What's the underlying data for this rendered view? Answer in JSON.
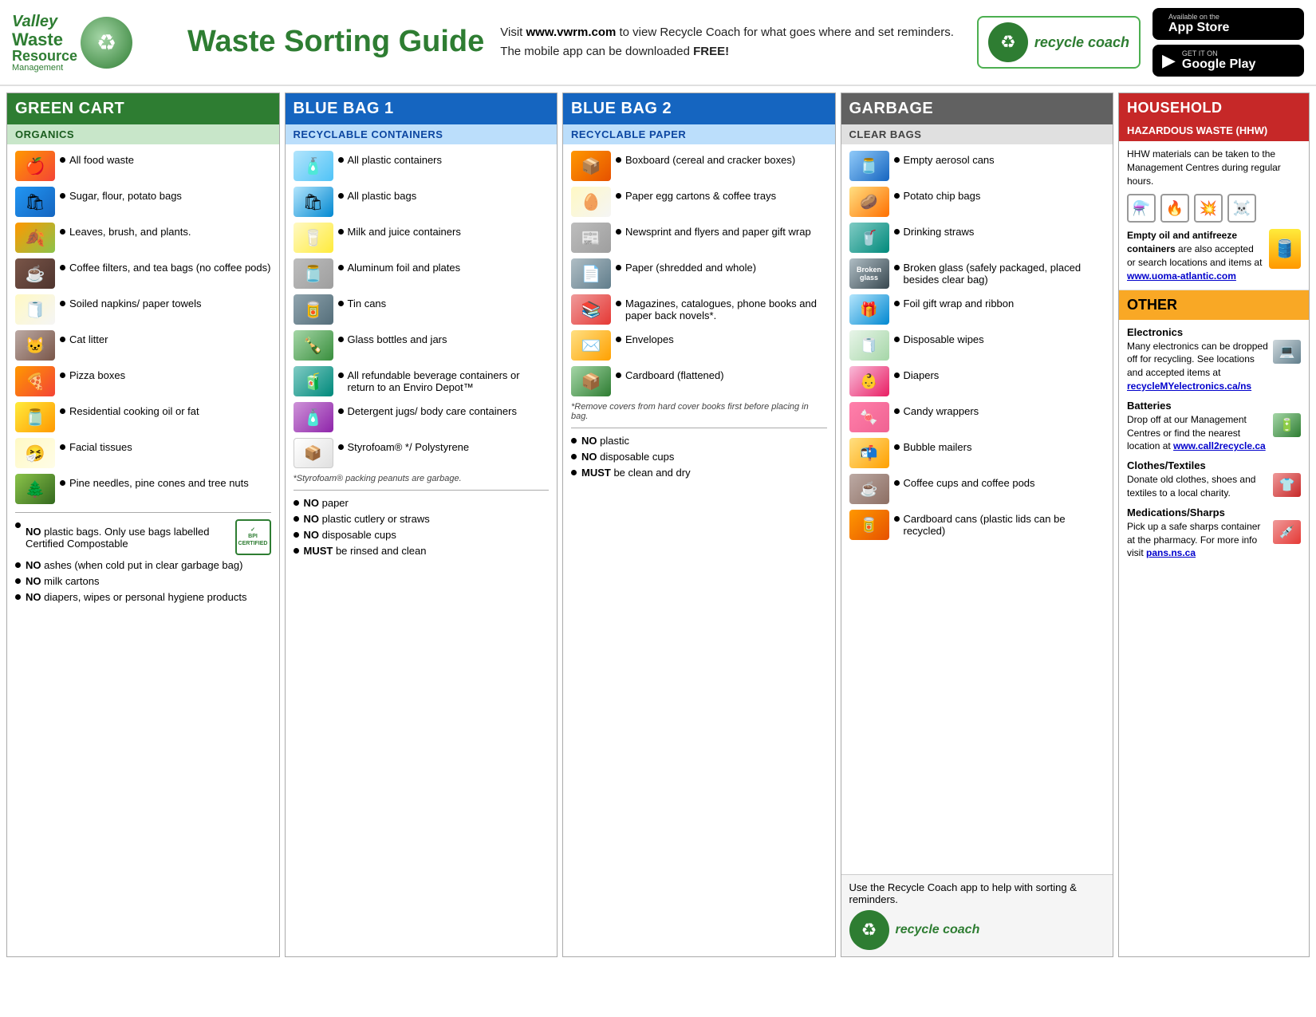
{
  "header": {
    "logo": {
      "line1": "Valley",
      "line2": "Waste",
      "line3": "Resource",
      "line4": "Management"
    },
    "title": "Waste Sorting Guide",
    "description": "Visit www.vwrm.com to view Recycle Coach for what goes where and set reminders. The mobile app can be downloaded FREE!",
    "website": "www.vwrm.com",
    "recycle_coach": "recycle coach",
    "app_store": "Available on App Store",
    "google_play": "Google GET IT ON Play"
  },
  "columns": {
    "green": {
      "header": "GREEN CART",
      "subheader": "ORGANICS",
      "items": [
        {
          "text": "All food waste"
        },
        {
          "text": "Sugar, flour, potato bags"
        },
        {
          "text": "Leaves, brush, and plants."
        },
        {
          "text": "Coffee filters, and tea bags (no coffee pods)"
        },
        {
          "text": "Soiled napkins/ paper towels"
        },
        {
          "text": "Cat litter"
        },
        {
          "text": "Pizza boxes"
        },
        {
          "text": "Residential cooking oil or fat"
        },
        {
          "text": "Facial tissues"
        },
        {
          "text": "Pine needles, pine cones and tree nuts"
        }
      ],
      "no_items": [
        {
          "text": "NO plastic bags. Only use bags labelled Certified Compostable"
        },
        {
          "text": "NO ashes (when cold put in clear garbage bag)"
        },
        {
          "text": "NO milk cartons"
        },
        {
          "text": "NO diapers, wipes or personal hygiene products"
        }
      ]
    },
    "blue1": {
      "header": "BLUE BAG 1",
      "subheader": "RECYCLABLE CONTAINERS",
      "items": [
        {
          "text": "All plastic containers"
        },
        {
          "text": "All plastic bags"
        },
        {
          "text": "Milk and juice containers"
        },
        {
          "text": "Aluminum foil and plates"
        },
        {
          "text": "Tin cans"
        },
        {
          "text": "Glass bottles and jars"
        },
        {
          "text": "All refundable beverage containers or return to an Enviro Depot™"
        },
        {
          "text": "Detergent jugs/ body care containers"
        },
        {
          "text": "Styrofoam® */ Polystyrene"
        }
      ],
      "note": "*Styrofoam® packing peanuts are garbage.",
      "no_items": [
        {
          "text": "NO paper"
        },
        {
          "text": "NO plastic cutlery or straws"
        },
        {
          "text": "NO disposable cups"
        },
        {
          "text": "MUST be rinsed and clean"
        }
      ]
    },
    "blue2": {
      "header": "BLUE BAG 2",
      "subheader": "RECYCLABLE PAPER",
      "items": [
        {
          "text": "Boxboard (cereal and cracker boxes)"
        },
        {
          "text": "Paper egg cartons  & coffee trays"
        },
        {
          "text": "Newsprint and flyers and paper gift wrap"
        },
        {
          "text": "Paper (shredded and whole)"
        },
        {
          "text": "Magazines, catalogues, phone books and paper back novels*."
        },
        {
          "text": "Envelopes"
        },
        {
          "text": "Cardboard (flattened)"
        }
      ],
      "note": "*Remove covers from hard cover books first before placing in bag.",
      "no_items": [
        {
          "text": "NO plastic"
        },
        {
          "text": "NO disposable cups"
        },
        {
          "text": "MUST be clean and dry"
        }
      ]
    },
    "garbage": {
      "header": "GARBAGE",
      "subheader": "CLEAR BAGS",
      "items": [
        {
          "text": "Empty aerosol cans"
        },
        {
          "text": "Potato chip bags"
        },
        {
          "text": "Drinking straws"
        },
        {
          "text": "Broken glass (safely packaged, placed besides clear bag)"
        },
        {
          "text": "Foil gift wrap and ribbon"
        },
        {
          "text": "Disposable wipes"
        },
        {
          "text": "Diapers"
        },
        {
          "text": "Candy wrappers"
        },
        {
          "text": "Bubble mailers"
        },
        {
          "text": "Coffee cups and coffee pods"
        },
        {
          "text": "Cardboard cans (plastic lids can be recycled)"
        }
      ],
      "footer_text": "Use the Recycle Coach app to help with sorting & reminders."
    },
    "hhw": {
      "header": "HOUSEHOLD",
      "subheader": "HAZARDOUS WASTE (HHW)",
      "body_text": "HHW materials can be taken to the Management Centres during regular hours.",
      "highlight1": "Empty oil and antifreeze containers",
      "highlight2": "are also accepted or search locations and items at",
      "link": "www.uoma-atlantic.com",
      "symbols": [
        "corrosive",
        "flammable",
        "explosive",
        "poison"
      ],
      "other_header": "OTHER",
      "other_items": [
        {
          "category": "Electronics",
          "text": "Many electronics can be dropped off for recycling. See locations and accepted items at",
          "link": "recycleMYelectronics.ca/ns"
        },
        {
          "category": "Batteries",
          "text": "Drop off at our Management Centres or find the nearest location at",
          "link": "www.call2recycle.ca"
        },
        {
          "category": "Clothes/Textiles",
          "text": "Donate old clothes, shoes and textiles to a local charity."
        },
        {
          "category": "Medications/Sharps",
          "text": "Pick up a safe sharps container at the pharmacy. For more info visit",
          "link": "pans.ns.ca"
        }
      ]
    }
  },
  "footer": {
    "recycle_coach": "recycle coach"
  }
}
